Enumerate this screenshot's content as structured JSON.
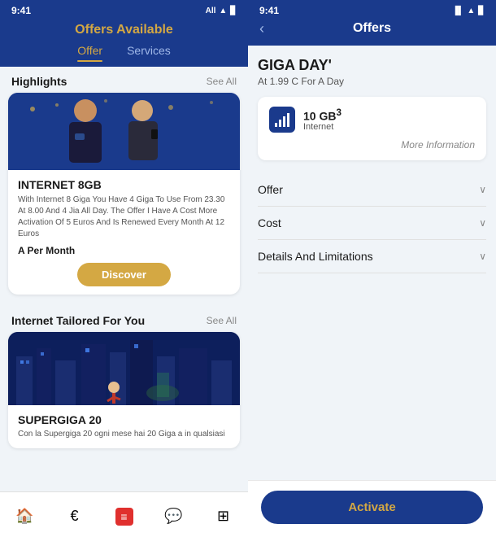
{
  "left": {
    "status_time": "9:41",
    "status_carrier": "All",
    "page_title": "Offers Available",
    "tabs": [
      {
        "label": "Offer",
        "active": true
      },
      {
        "label": "Services",
        "active": false
      }
    ],
    "highlights_label": "Highlights",
    "see_all_label": "See All",
    "card1": {
      "name": "INTERNET 8GB",
      "description": "With Internet 8 Giga You Have 4 Giga To Use From 23.30 At 8.00 And 4 Jia All Day. The Offer I Have A Cost More Activation Of 5 Euros And Is Renewed Every Month At 12 Euros",
      "price": "A Per Month",
      "discover_label": "Discover"
    },
    "section2_label": "Internet Tailored For You",
    "see_all2_label": "See All",
    "card2": {
      "name": "SUPERGIGA 20",
      "description": "Con la Supergiga 20 ogni mese hai 20 Giga a in qualsiasi"
    },
    "nav": [
      {
        "icon": "🏠",
        "name": "home"
      },
      {
        "icon": "€",
        "name": "offers"
      },
      {
        "icon": "☰",
        "name": "services",
        "red": true
      },
      {
        "icon": "💬",
        "name": "messages"
      },
      {
        "icon": "⊞",
        "name": "menu"
      }
    ]
  },
  "right": {
    "status_time": "9:41",
    "back_label": "‹",
    "page_title": "Offers",
    "offer_name": "GIGA DAY'",
    "offer_subtitle": "At 1.99 C For A Day",
    "giga_amount": "10 GB",
    "giga_superscript": "3",
    "giga_label": "Internet",
    "more_info_label": "More Information",
    "accordion": [
      {
        "label": "Offer"
      },
      {
        "label": "Cost"
      },
      {
        "label": "Details And Limitations"
      }
    ],
    "activate_label": "Activate"
  },
  "colors": {
    "brand_blue": "#1a3a8c",
    "brand_gold": "#d4a843",
    "background": "#f0f4f8",
    "text_primary": "#1a1a1a",
    "text_secondary": "#555555"
  }
}
